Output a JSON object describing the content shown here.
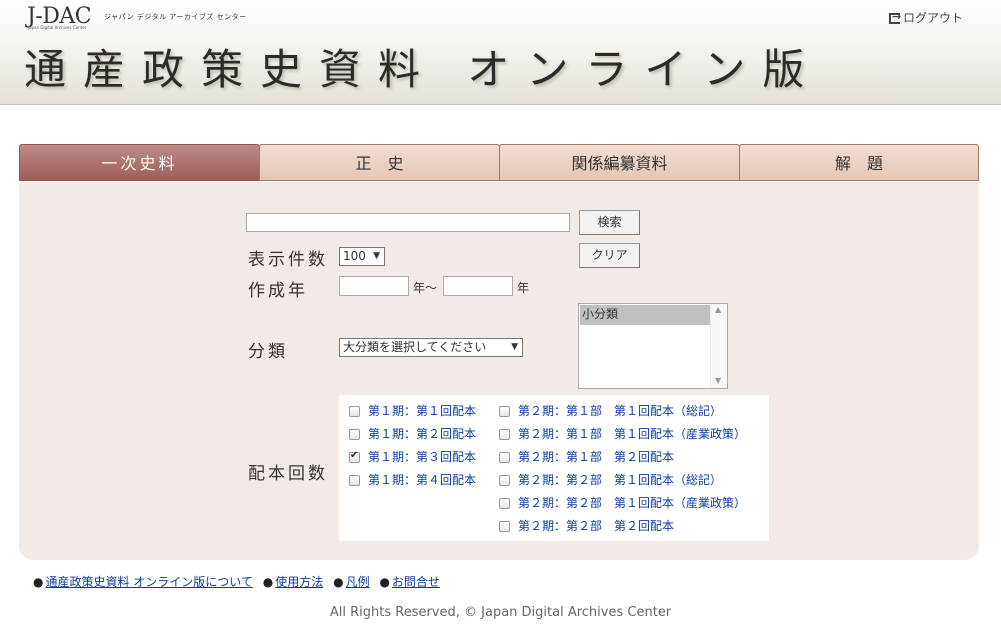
{
  "header": {
    "logo_text": "J-DAC",
    "logo_sub": "Japan Digital Archives Center",
    "logo_jp": "ジャパン デジタル アーカイブズ センター",
    "title": "通産政策史資料 オンライン版",
    "logout_label": "ログアウト",
    "logout_icon": "logout-icon"
  },
  "tabs": [
    {
      "label": "一次史料",
      "active": true
    },
    {
      "label": "正　史",
      "active": false
    },
    {
      "label": "関係編纂資料",
      "active": false
    },
    {
      "label": "解　題",
      "active": false
    }
  ],
  "search": {
    "query_value": "",
    "search_button": "検索",
    "clear_button": "クリア"
  },
  "display_count": {
    "label": "表示件数",
    "value": "100"
  },
  "year": {
    "label": "作成年",
    "from_value": "",
    "to_value": "",
    "from_suffix": "年～",
    "to_suffix": "年"
  },
  "category": {
    "label": "分類",
    "major_select_value": "大分類を選択してください",
    "minor_list": [
      "小分類"
    ]
  },
  "issues": {
    "label": "配本回数",
    "items": [
      {
        "label": "第１期：第１回配本",
        "checked": false
      },
      {
        "label": "第１期：第２回配本",
        "checked": false
      },
      {
        "label": "第１期：第３回配本",
        "checked": true
      },
      {
        "label": "第１期：第４回配本",
        "checked": false
      },
      {
        "label": "第２期：第１部　第１回配本（総記）",
        "checked": false
      },
      {
        "label": "第２期：第１部　第１回配本（産業政策）",
        "checked": false
      },
      {
        "label": "第２期：第１部　第２回配本",
        "checked": false
      },
      {
        "label": "第２期：第２部　第１回配本（総記）",
        "checked": false
      },
      {
        "label": "第２期：第２部　第１回配本（産業政策）",
        "checked": false
      },
      {
        "label": "第２期：第２部　第２回配本",
        "checked": false
      }
    ]
  },
  "footer": {
    "links": [
      "通産政策史資料 オンライン版について",
      "使用方法",
      "凡例",
      "お問合せ"
    ],
    "bullet": "●",
    "copyright": "All Rights Reserved, © Japan Digital Archives Center"
  },
  "colors": {
    "active_tab": "#a56a66",
    "inactive_tab": "#ecd2c3",
    "panel_bg": "#f2eae7",
    "link": "#0b3ca5"
  }
}
